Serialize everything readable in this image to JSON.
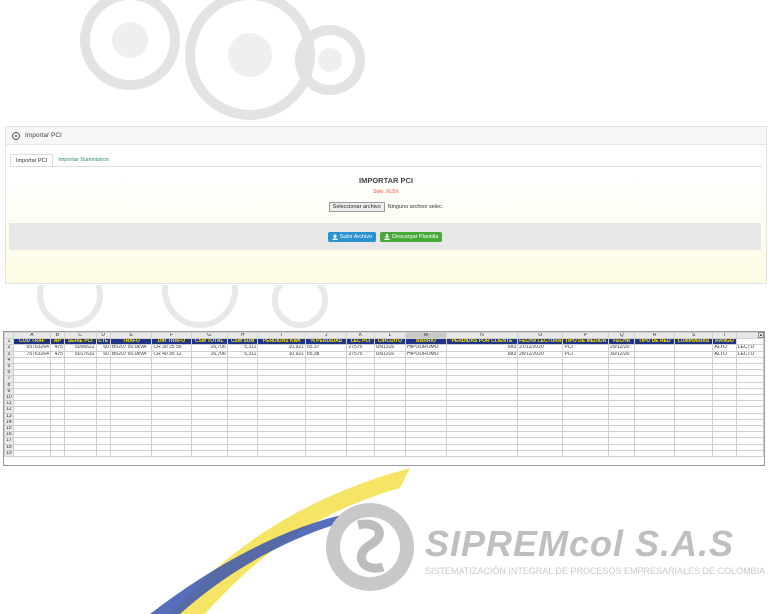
{
  "panel": {
    "title": "Importar PCI"
  },
  "tabs": [
    {
      "label": "Importar PCI",
      "active": true
    },
    {
      "label": "Importar Suministros",
      "active": false
    }
  ],
  "import": {
    "heading": "IMPORTAR PCI",
    "subheading": "Solo .XLSX",
    "choose_file": "Seleccionar archivo",
    "no_file": "Ninguno archivo selec."
  },
  "actions": {
    "upload": "Subir Archivo",
    "download": "Descargar Plantilla"
  },
  "sheet": {
    "columns": [
      "A",
      "B",
      "C",
      "D",
      "E",
      "F",
      "G",
      "H",
      "I",
      "J",
      "K",
      "L",
      "M",
      "N",
      "O",
      "P",
      "Q",
      "R",
      "S",
      "T"
    ],
    "headers": [
      "COD TRAF",
      "AP",
      "SERIE PCI",
      "CTE",
      "TRAFO",
      "DIR TRAFO",
      "CSM TOTAL",
      "CSM SUM",
      "PERDIDAS Kwh",
      "% PERDIDAS",
      "LEC PCI",
      "CIRCUITO",
      "BARRIO",
      "PERDIDAS POR CLIENTE",
      "FECHA LECTURA",
      "TIPO DE MEDIDA",
      "FECHA",
      "TIPO DE RED",
      "LUMINARIAS",
      "RANGO"
    ],
    "rows": [
      [
        "65763264",
        "475",
        "5006622",
        "60",
        "B5207 50.0kVA",
        "CR 30 25 56",
        "16,706",
        "5,311",
        "10,921",
        "65,37",
        "27575",
        "UN1316",
        "HIPODROMO",
        "683",
        "27/11/2020",
        "PCI",
        "29/12/20",
        "",
        "",
        "ALTO",
        "LECTU"
      ],
      [
        "75763264",
        "475",
        "5017632",
        "60",
        "B5207 50.0kVA",
        "CR 40 35 12",
        "16,706",
        "5,311",
        "10,921",
        "65,38",
        "27575",
        "UN1316",
        "HIPODROMO",
        "683",
        "28/11/2020",
        "PCI",
        "30/12/20",
        "",
        "",
        "ALTO",
        "LECTU"
      ]
    ],
    "row_numbers": [
      "1",
      "2",
      "3",
      "4",
      "5",
      "6",
      "7",
      "8",
      "9",
      "10",
      "11",
      "12",
      "13",
      "14",
      "15",
      "16",
      "17",
      "18",
      "19"
    ]
  },
  "brand": {
    "name": "SIPREMcol S.A.S",
    "tagline": "SISTEMATIZACIÓN INTEGRAL DE PROCESOS EMPRESARIALES DE COLOMBIA",
    "primary": "#1f3486",
    "accent": "#ffe600"
  }
}
